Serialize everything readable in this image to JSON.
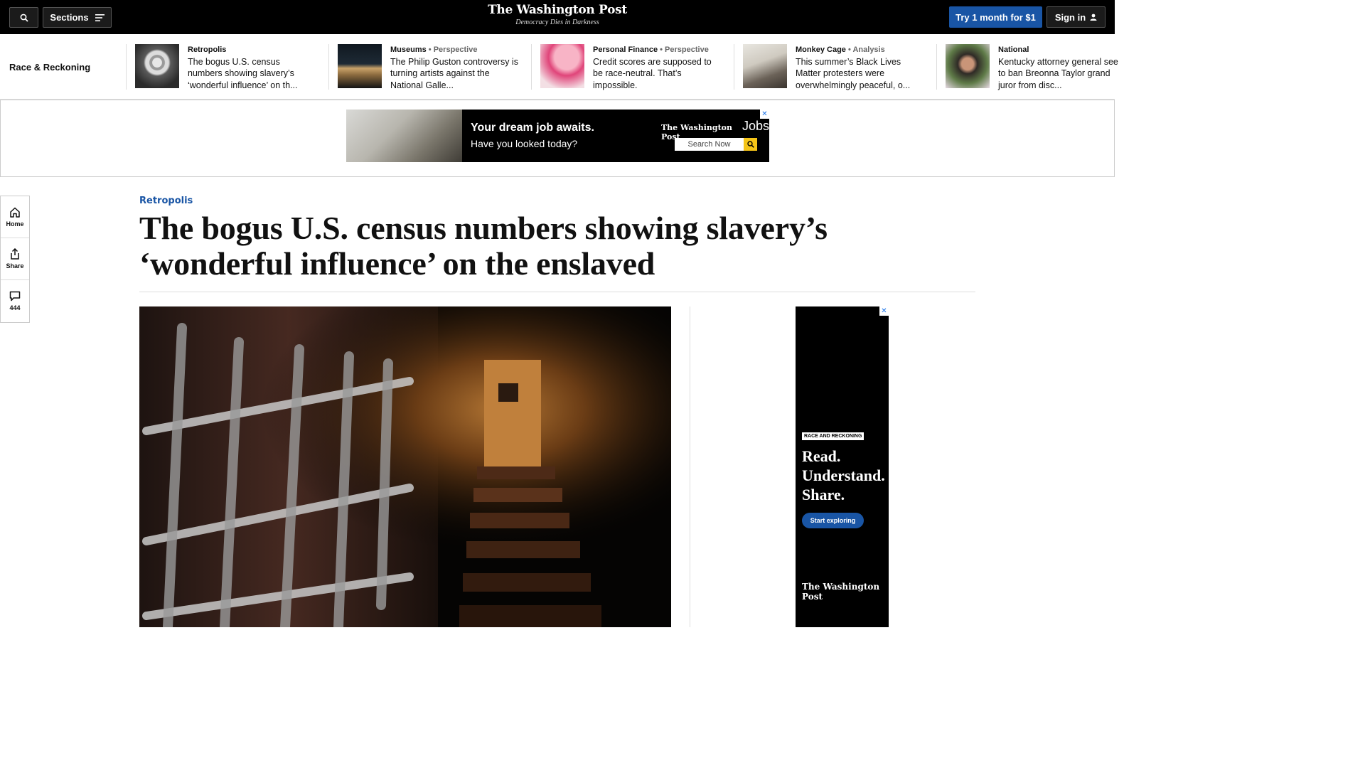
{
  "header": {
    "search_icon": "search-icon",
    "sections_label": "Sections",
    "logo": "The Washington Post",
    "tagline": "Democracy Dies in Darkness",
    "try_label": "Try 1 month for $1",
    "signin_label": "Sign in"
  },
  "rail": {
    "title": "Race & Reckoning",
    "items": [
      {
        "kicker": "Retropolis",
        "tag": "",
        "text": "The bogus U.S. census numbers showing slavery’s ‘wonderful influence’ on th..."
      },
      {
        "kicker": "Museums",
        "tag": " • Perspective",
        "text": "The Philip Guston controversy is turning artists against the National Galle..."
      },
      {
        "kicker": "Personal Finance",
        "tag": " • Perspective",
        "text": "Credit scores are supposed to be race-neutral. That’s impossible."
      },
      {
        "kicker": "Monkey Cage",
        "tag": " • Analysis",
        "text": "This summer’s Black Lives Matter protesters were overwhelmingly peaceful, o..."
      },
      {
        "kicker": "National",
        "tag": "",
        "text": "Kentucky attorney general see to ban Breonna Taylor grand juror from disc..."
      }
    ]
  },
  "ad_banner": {
    "line1": "Your dream job awaits.",
    "line2": "Have you looked today?",
    "brand": "The Washington Post",
    "brand_jobs": "Jobs",
    "search_label": "Search Now",
    "close": "✕"
  },
  "toolbar": {
    "home_label": "Home",
    "share_label": "Share",
    "comments_count": "444"
  },
  "article": {
    "kicker": "Retropolis",
    "headline": "The bogus U.S. census numbers showing slavery’s ‘wonderful influence’ on the enslaved"
  },
  "side_ad": {
    "badge": "RACE AND RECKONING",
    "headline": "Read. Understand. Share.",
    "cta": "Start exploring",
    "logo": "The Washington Post",
    "close": "✕"
  },
  "colors": {
    "accent": "#1955a5",
    "header_bg": "#000000"
  }
}
